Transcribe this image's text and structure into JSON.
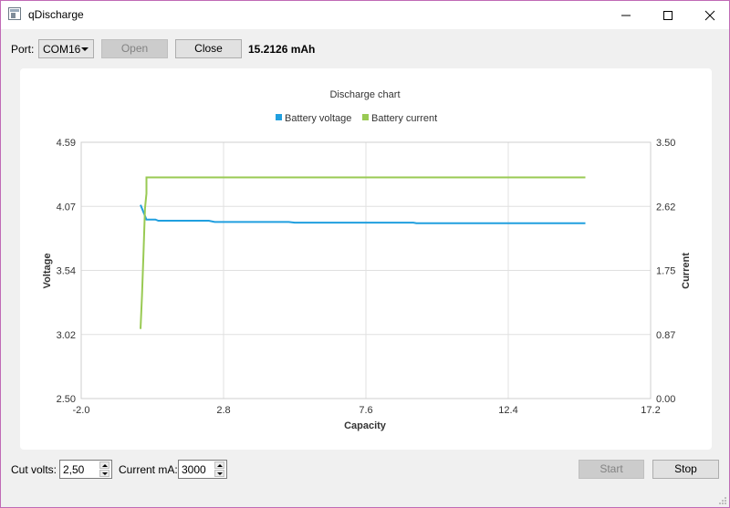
{
  "window": {
    "title": "qDischarge"
  },
  "toolbar": {
    "port_label": "Port:",
    "port_value": "COM16",
    "open_label": "Open",
    "close_label": "Close",
    "capacity_readout": "15.2126 mAh"
  },
  "bottom": {
    "cut_volts_label": "Cut volts:",
    "cut_volts_value": "2,50",
    "current_label": "Current mA:",
    "current_value": "3000",
    "start_label": "Start",
    "stop_label": "Stop"
  },
  "chart_data": {
    "type": "line",
    "title": "Discharge chart",
    "xlabel": "Capacity",
    "ylabel_left": "Voltage",
    "ylabel_right": "Current",
    "xlim": [
      -2.0,
      17.2
    ],
    "ylim_left": [
      2.5,
      4.59
    ],
    "ylim_right": [
      0.0,
      3.5
    ],
    "xticks": [
      "-2.0",
      "2.8",
      "7.6",
      "12.4",
      "17.2"
    ],
    "yticks_left": [
      "4.59",
      "4.07",
      "3.54",
      "3.02",
      "2.50"
    ],
    "yticks_right": [
      "3.50",
      "2.62",
      "1.75",
      "0.87",
      "0.00"
    ],
    "grid": true,
    "legend_position": "top",
    "series": [
      {
        "name": "Battery voltage",
        "axis": "left",
        "color": "#209fdf",
        "points": [
          [
            0.0,
            4.08
          ],
          [
            0.2,
            3.96
          ],
          [
            0.3,
            3.96
          ],
          [
            0.5,
            3.96
          ],
          [
            0.6,
            3.95
          ],
          [
            1.0,
            3.95
          ],
          [
            1.5,
            3.95
          ],
          [
            2.0,
            3.95
          ],
          [
            2.3,
            3.95
          ],
          [
            2.5,
            3.94
          ],
          [
            5.0,
            3.94
          ],
          [
            5.2,
            3.935
          ],
          [
            8.0,
            3.935
          ],
          [
            9.2,
            3.935
          ],
          [
            9.3,
            3.93
          ],
          [
            15.0,
            3.93
          ]
        ]
      },
      {
        "name": "Battery current",
        "axis": "right",
        "color": "#99ca53",
        "points": [
          [
            0.0,
            0.95
          ],
          [
            0.05,
            1.4
          ],
          [
            0.1,
            2.0
          ],
          [
            0.15,
            2.6
          ],
          [
            0.2,
            2.8
          ],
          [
            0.2,
            3.02
          ],
          [
            0.5,
            3.02
          ],
          [
            15.0,
            3.02
          ]
        ]
      }
    ]
  }
}
